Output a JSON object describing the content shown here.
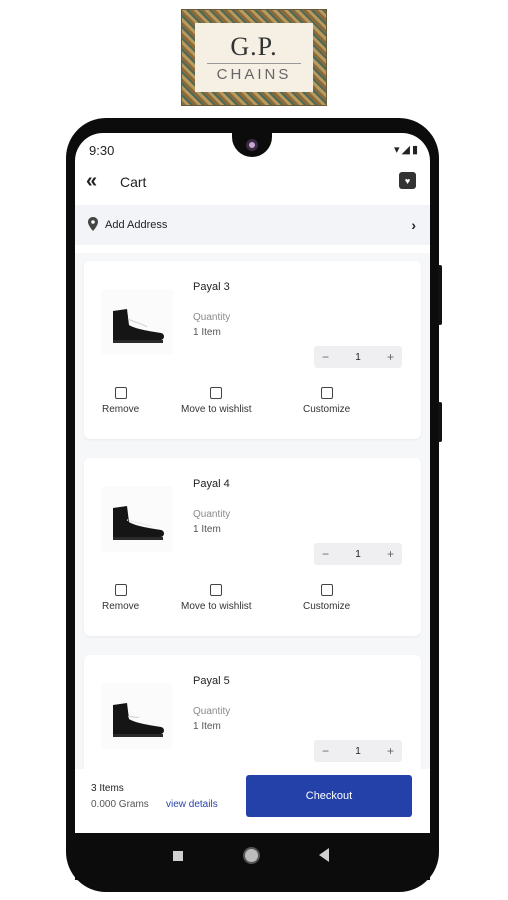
{
  "logo": {
    "main": "G.P.",
    "sub": "CHAINS"
  },
  "status": {
    "time": "9:30"
  },
  "header": {
    "title": "Cart"
  },
  "address": {
    "label": "Add Address"
  },
  "actions": {
    "remove": "Remove",
    "wishlist": "Move to wishlist",
    "customize": "Customize"
  },
  "items": [
    {
      "name": "Payal 3",
      "qty_label": "Quantity",
      "qty_value": "1 Item",
      "count": "1"
    },
    {
      "name": "Payal 4",
      "qty_label": "Quantity",
      "qty_value": "1 Item",
      "count": "1"
    },
    {
      "name": "Payal 5",
      "qty_label": "Quantity",
      "qty_value": "1 Item",
      "count": "1"
    }
  ],
  "footer": {
    "items": "3 Items",
    "grams": "0.000 Grams",
    "view_details": "view details",
    "checkout": "Checkout"
  },
  "colors": {
    "accent": "#2341a9",
    "link": "#2a44a8"
  },
  "icons": [
    "back-chevron-icon",
    "bag-icon",
    "location-pin-icon",
    "chevron-right-icon",
    "trash-icon",
    "wishlist-icon",
    "customize-icon"
  ]
}
